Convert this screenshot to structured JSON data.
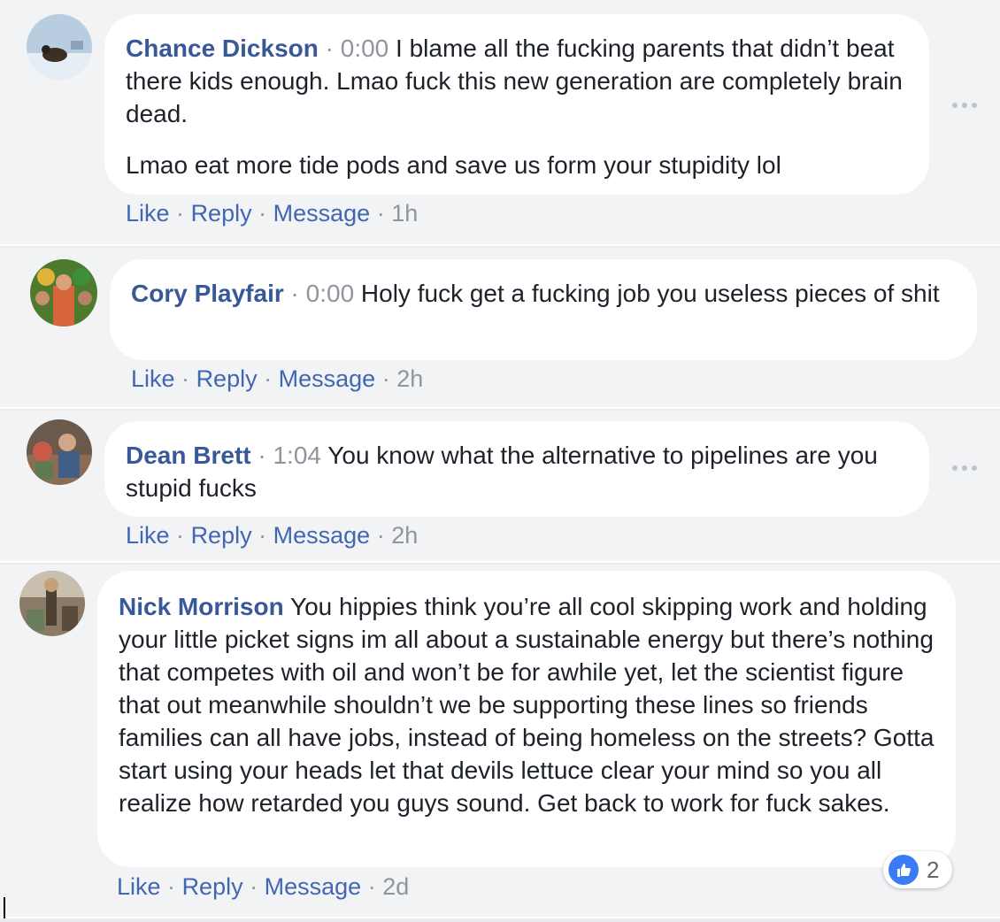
{
  "colors": {
    "background": "#f2f3f5",
    "bubble": "#ffffff",
    "name": "#385898",
    "action_link": "#4267b2",
    "meta": "#90949c",
    "like_blue": "#3b7cf5"
  },
  "comments": [
    {
      "author": "Chance Dickson",
      "sep": "·",
      "timestamp": "0:00",
      "paragraphs": [
        "I blame all the fucking parents that didn’t beat there kids enough. Lmao fuck this new generation are completely brain dead.",
        "Lmao eat more tide pods and save us form your stupidity lol"
      ],
      "actions": {
        "like": "Like",
        "reply": "Reply",
        "message": "Message",
        "time": "1h",
        "sep": "·"
      },
      "more_icon": "ellipsis-icon"
    },
    {
      "author": "Cory Playfair",
      "sep": "·",
      "timestamp": "0:00",
      "paragraphs": [
        "Holy fuck get a fucking job you useless pieces of shit"
      ],
      "actions": {
        "like": "Like",
        "reply": "Reply",
        "message": "Message",
        "time": "2h",
        "sep": "·"
      }
    },
    {
      "author": "Dean Brett",
      "sep": "·",
      "timestamp": "1:04",
      "paragraphs": [
        "You know what the alternative to pipelines are you stupid fucks"
      ],
      "actions": {
        "like": "Like",
        "reply": "Reply",
        "message": "Message",
        "time": "2h",
        "sep": "·"
      },
      "more_icon": "ellipsis-icon"
    },
    {
      "author": "Nick Morrison",
      "paragraphs": [
        "You hippies think you’re all cool skipping work and holding your little picket signs im all about a sustainable energy but there’s nothing that competes with oil and won’t be for awhile yet, let the scientist figure that out meanwhile shouldn’t we be supporting these lines so friends families can all have jobs, instead of being homeless on the streets? Gotta start using your heads let that devils lettuce clear your mind so you all realize how retarded you guys sound. Get back to work for fuck sakes."
      ],
      "actions": {
        "like": "Like",
        "reply": "Reply",
        "message": "Message",
        "time": "2d",
        "sep": "·"
      },
      "reaction": {
        "icon": "thumbs-up-icon",
        "count": "2"
      }
    }
  ]
}
